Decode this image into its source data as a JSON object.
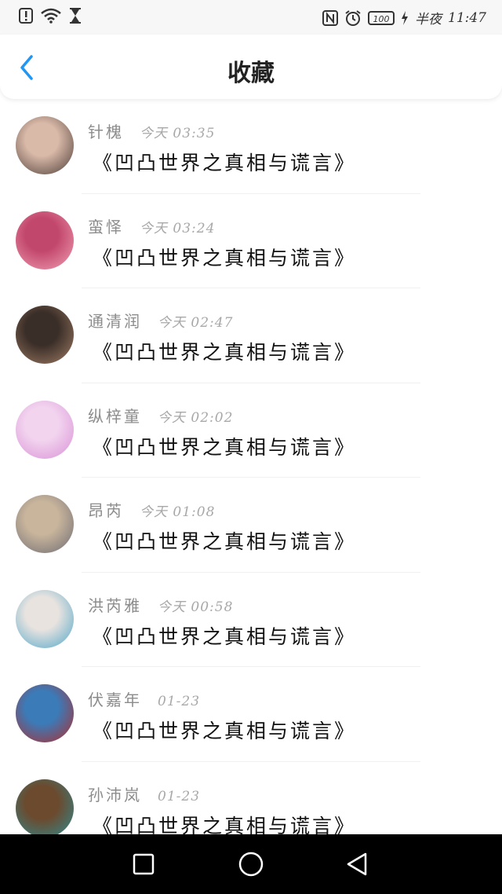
{
  "status_bar": {
    "time_prefix": "半夜",
    "time": "11:47",
    "battery": "100",
    "icons": [
      "alert-icon",
      "wifi-icon",
      "hourglass-icon",
      "nfc-icon",
      "alarm-icon",
      "battery-icon",
      "charging-icon"
    ]
  },
  "header": {
    "title": "收藏",
    "back_icon": "chevron-left-icon",
    "accent_color": "#2196f3"
  },
  "favorites": [
    {
      "name": "针槐",
      "time": "今天 03:35",
      "content": "《凹凸世界之真相与谎言》",
      "avatar_colors": [
        "#d9b9a8",
        "#4a3b36"
      ]
    },
    {
      "name": "蛮怿",
      "time": "今天 03:24",
      "content": "《凹凸世界之真相与谎言》",
      "avatar_colors": [
        "#c2476c",
        "#f1a0b5"
      ]
    },
    {
      "name": "通清润",
      "time": "今天 02:47",
      "content": "《凹凸世界之真相与谎言》",
      "avatar_colors": [
        "#3a2e28",
        "#a27e66"
      ]
    },
    {
      "name": "纵梓童",
      "time": "今天 02:02",
      "content": "《凹凸世界之真相与谎言》",
      "avatar_colors": [
        "#f2d4ef",
        "#d98fd6"
      ]
    },
    {
      "name": "昂芮",
      "time": "今天 01:08",
      "content": "《凹凸世界之真相与谎言》",
      "avatar_colors": [
        "#c9b59c",
        "#6d6b73"
      ]
    },
    {
      "name": "洪芮雅",
      "time": "今天 00:58",
      "content": "《凹凸世界之真相与谎言》",
      "avatar_colors": [
        "#e8e3df",
        "#4fa6c9"
      ]
    },
    {
      "name": "伏嘉年",
      "time": "01-23",
      "content": "《凹凸世界之真相与谎言》",
      "avatar_colors": [
        "#3b7bb8",
        "#b32a2a"
      ]
    },
    {
      "name": "孙沛岚",
      "time": "01-23",
      "content": "《凹凸世界之真相与谎言》",
      "avatar_colors": [
        "#6b4a2e",
        "#2f8d92"
      ]
    }
  ],
  "nav_bar": {
    "recent_icon": "square-recents-icon",
    "home_icon": "circle-home-icon",
    "back_icon": "triangle-back-icon"
  }
}
